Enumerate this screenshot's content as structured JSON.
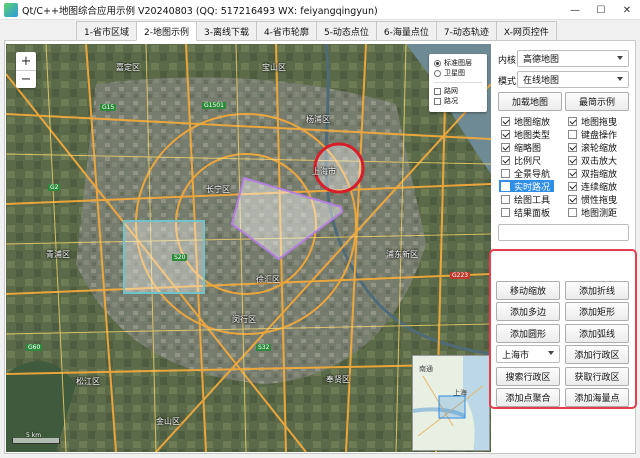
{
  "window": {
    "title": "Qt/C++地图综合应用示例 V20240803 (QQ: 517216493 WX: feiyangqingyun)",
    "minimize_glyph": "—",
    "maximize_glyph": "☐",
    "close_glyph": "✕"
  },
  "tabs": [
    "1-省市区域",
    "2-地图示例",
    "3-离线下载",
    "4-省市轮廓",
    "5-动态点位",
    "6-海量点位",
    "7-动态轨迹",
    "X-网页控件"
  ],
  "active_tab_index": 1,
  "map": {
    "zoom_in": "+",
    "zoom_out": "−",
    "layer_options": [
      {
        "label": "标准图层",
        "selected": true
      },
      {
        "label": "卫星图",
        "selected": false
      }
    ],
    "overlay_options": [
      {
        "label": "路网",
        "checked": false
      },
      {
        "label": "路况",
        "checked": false
      }
    ],
    "place_labels": [
      "嘉定区",
      "宝山区",
      "上海市",
      "长宁区",
      "青浦区",
      "闵行区",
      "浦东新区",
      "奉贤区",
      "松江区",
      "金山区",
      "南通",
      "杨浦区",
      "徐汇区"
    ],
    "road_badges": [
      "G15",
      "G1501",
      "G2",
      "S20",
      "G60",
      "S32",
      "G223"
    ],
    "scale_text": "5 km",
    "overview_labels": [
      "南通",
      "上海"
    ]
  },
  "sidebar": {
    "kernel_label": "内核",
    "kernel_value": "高德地图",
    "mode_label": "模式",
    "mode_value": "在线地图",
    "load_map_button": "加载地图",
    "simplest_example_button": "最简示例",
    "left_checks": [
      {
        "label": "地图缩放",
        "checked": true
      },
      {
        "label": "地图类型",
        "checked": true
      },
      {
        "label": "缩略图",
        "checked": true
      },
      {
        "label": "比例尺",
        "checked": true
      },
      {
        "label": "全景导航",
        "checked": false
      },
      {
        "label": "实时路况",
        "checked": false,
        "highlighted": true
      },
      {
        "label": "绘图工具",
        "checked": false
      },
      {
        "label": "结果面板",
        "checked": false
      }
    ],
    "right_checks": [
      {
        "label": "地图拖曳",
        "checked": true
      },
      {
        "label": "键盘操作",
        "checked": false
      },
      {
        "label": "滚轮缩放",
        "checked": true
      },
      {
        "label": "双击放大",
        "checked": true
      },
      {
        "label": "双指缩放",
        "checked": true
      },
      {
        "label": "连续缩放",
        "checked": true
      },
      {
        "label": "惯性拖曳",
        "checked": true
      },
      {
        "label": "地图测距",
        "checked": false
      }
    ],
    "input_value": "",
    "action_buttons": [
      [
        "移动缩放",
        "添加折线"
      ],
      [
        "添加多边",
        "添加矩形"
      ],
      [
        "添加圆形",
        "添加弧线"
      ]
    ],
    "city_combo": "上海市",
    "add_region_button": "添加行政区",
    "bottom_buttons": [
      [
        "搜索行政区",
        "获取行政区"
      ],
      [
        "添加点聚合",
        "添加海量点"
      ]
    ]
  },
  "colors": {
    "accent": "#2f8ee5",
    "frame_red": "#e33d4e",
    "circle_red": "#d81e2b",
    "polygon_purple": "#b480e0",
    "rect_teal": "#6fc3c9"
  }
}
